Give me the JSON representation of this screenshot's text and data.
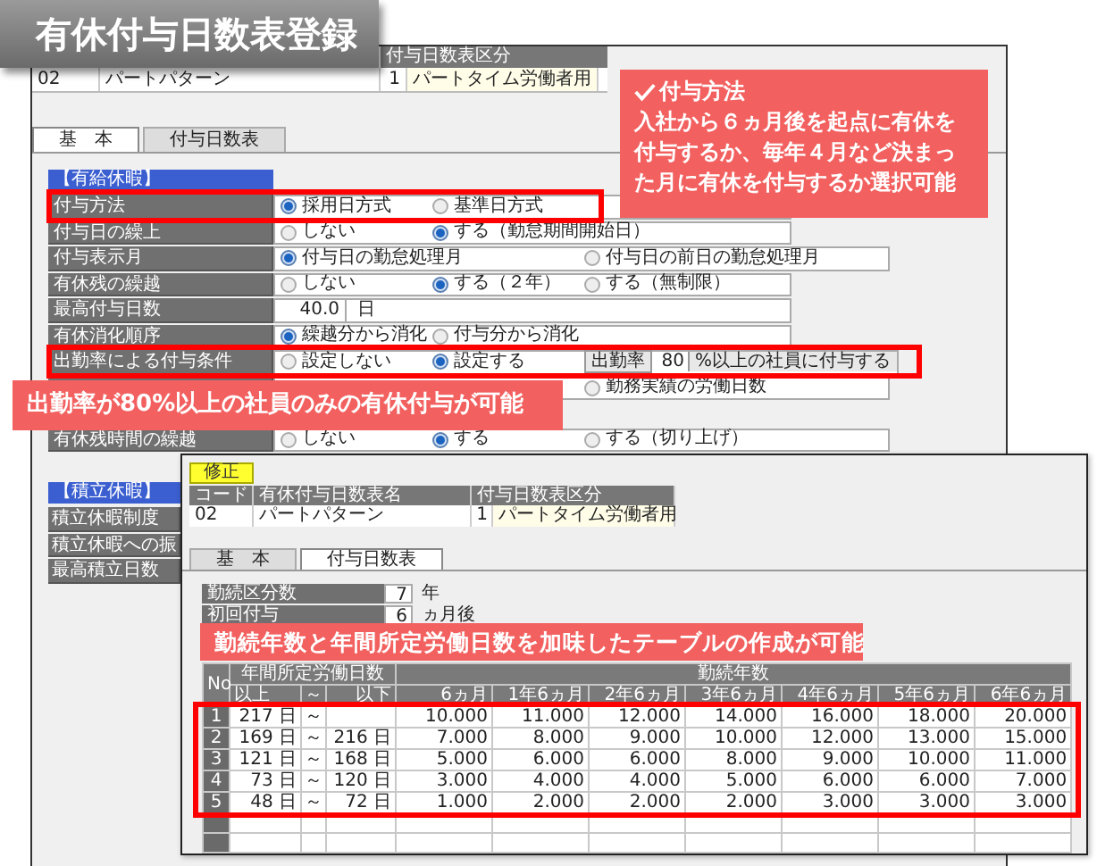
{
  "title": "有休付与日数表登録",
  "back_window": {
    "header": "付与日数表区分",
    "record": {
      "code": "02",
      "name": "パートパターン",
      "type_no": "1",
      "type_name": "パートタイム労働者用"
    },
    "tabs": [
      {
        "label": "基　本",
        "selected": true
      },
      {
        "label": "付与日数表",
        "selected": false
      }
    ],
    "sections": [
      {
        "heading": "【有給休暇】",
        "rows": [
          {
            "kind": "radio",
            "label": "付与方法",
            "options": [
              {
                "label": "採用日方式",
                "selected": true
              },
              {
                "label": "基準日方式",
                "selected": false
              }
            ]
          },
          {
            "kind": "radio",
            "label": "付与日の繰上",
            "options": [
              {
                "label": "しない",
                "selected": false
              },
              {
                "label": "する（勤怠期間開始日）",
                "selected": true
              }
            ]
          },
          {
            "kind": "radio",
            "label": "付与表示月",
            "options": [
              {
                "label": "付与日の勤怠処理月",
                "selected": true
              },
              {
                "label": "付与日の前日の勤怠処理月",
                "selected": false
              }
            ]
          },
          {
            "kind": "radio",
            "label": "有休残の繰越",
            "options": [
              {
                "label": "しない",
                "selected": false
              },
              {
                "label": "する（２年）",
                "selected": true
              },
              {
                "label": "する（無制限）",
                "selected": false
              }
            ]
          },
          {
            "kind": "number",
            "label": "最高付与日数",
            "value": "40.0",
            "unit": "日"
          },
          {
            "kind": "radio",
            "label": "有休消化順序",
            "options": [
              {
                "label": "繰越分から消化",
                "selected": true
              },
              {
                "label": "付与分から消化",
                "selected": false
              }
            ]
          },
          {
            "kind": "rate",
            "label": "出勤率による付与条件",
            "options": [
              {
                "label": "設定しない",
                "selected": false
              },
              {
                "label": "設定する",
                "selected": true
              }
            ],
            "rate_label": "出勤率",
            "rate_value": "80",
            "rate_suffix": "%以上の社員に付与する"
          },
          {
            "kind": "covered_radio",
            "options": [
              {
                "label": "勤務実績の労働日数",
                "selected": false
              }
            ]
          },
          {
            "kind": "covered"
          },
          {
            "kind": "radio",
            "label": "有休残時間の繰越",
            "options": [
              {
                "label": "しない",
                "selected": false
              },
              {
                "label": "する",
                "selected": true
              },
              {
                "label": "する（切り上げ）",
                "selected": false
              }
            ]
          }
        ]
      },
      {
        "heading": "【積立休暇】",
        "rows": [
          {
            "kind": "label_only",
            "label": "積立休暇制度"
          },
          {
            "kind": "label_only",
            "label": "積立休暇への振"
          },
          {
            "kind": "label_only",
            "label": "最高積立日数"
          }
        ]
      }
    ]
  },
  "front_window": {
    "edit_button": "修正",
    "header": [
      "コード",
      "有休付与日数表名",
      "付与日数表区分"
    ],
    "record": {
      "code": "02",
      "name": "パートパターン",
      "type_no": "1",
      "type_name": "パートタイム労働者用"
    },
    "tabs": [
      {
        "label": "基　本",
        "selected": false
      },
      {
        "label": "付与日数表",
        "selected": true
      }
    ],
    "fields": [
      {
        "label": "勤続区分数",
        "value": "7",
        "unit": "年"
      },
      {
        "label": "初回付与",
        "value": "6",
        "unit": "ヵ月後"
      }
    ],
    "table": {
      "group_headers": [
        "年間所定労働日数",
        "勤続年数"
      ],
      "no_header": "No",
      "range_headers": [
        "以上",
        "～",
        "以下"
      ],
      "columns": [
        "6ヵ月",
        "1年6ヵ月",
        "2年6ヵ月",
        "3年6ヵ月",
        "4年6ヵ月",
        "5年6ヵ月",
        "6年6ヵ月"
      ],
      "rows": [
        {
          "no": "1",
          "from": "217 日",
          "tilde": "～",
          "values": [
            "10.000",
            "11.000",
            "12.000",
            "14.000",
            "16.000",
            "18.000",
            "20.000"
          ]
        },
        {
          "no": "2",
          "from": "169 日",
          "tilde": "～",
          "to": "216 日",
          "values": [
            "7.000",
            "8.000",
            "9.000",
            "10.000",
            "12.000",
            "13.000",
            "15.000"
          ]
        },
        {
          "no": "3",
          "from": "121 日",
          "tilde": "～",
          "to": "168 日",
          "values": [
            "5.000",
            "6.000",
            "6.000",
            "8.000",
            "9.000",
            "10.000",
            "11.000"
          ]
        },
        {
          "no": "4",
          "from": "73 日",
          "tilde": "～",
          "to": "120 日",
          "values": [
            "3.000",
            "4.000",
            "4.000",
            "5.000",
            "6.000",
            "6.000",
            "7.000"
          ]
        },
        {
          "no": "5",
          "from": "48 日",
          "tilde": "～",
          "to": "72 日",
          "values": [
            "1.000",
            "2.000",
            "2.000",
            "2.000",
            "3.000",
            "3.000",
            "3.000"
          ]
        }
      ]
    }
  },
  "callouts": [
    {
      "kind": "titled",
      "title": "付与方法",
      "text": "入社から６ヵ月後を起点に有休を付与するか、毎年４月など決まった月に有休を付与するか選択可能"
    },
    {
      "kind": "plain",
      "text": "出勤率が80%以上の社員のみの有休付与が可能"
    },
    {
      "kind": "plain",
      "text": "勤続年数と年間所定労働日数を加味したテーブルの作成が可能"
    }
  ]
}
